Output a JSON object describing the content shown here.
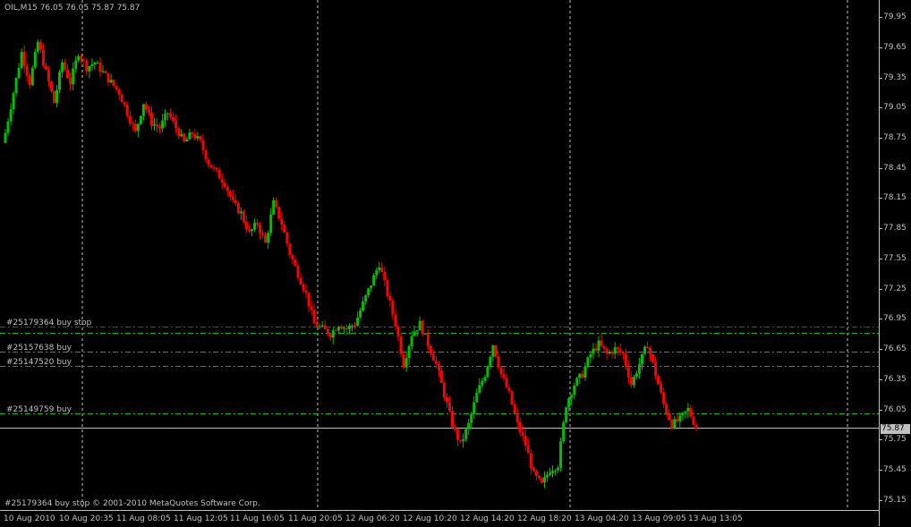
{
  "header": {
    "symbol_info": "OIL,M15  76.05 76.05 75.87 75.87"
  },
  "footer": {
    "copyright": "#25179364 buy stop © 2001-2010 MetaQuotes Software Corp."
  },
  "bid": {
    "label": "75.87",
    "value": 75.87
  },
  "colors": {
    "background": "#000000",
    "bull": "#00c000",
    "bear": "#ff0000",
    "grid": "#c0c0c0",
    "pending_line": "#ff0000",
    "order_line": "#00c000",
    "bid_line": "#c0c0c0"
  },
  "orders": [
    {
      "label": "#25179364 buy stop",
      "price": 76.87,
      "kind": "pending"
    },
    {
      "label": "",
      "price": 76.81,
      "kind": "order"
    },
    {
      "label": "#25157638 buy",
      "price": 76.62,
      "kind": "order"
    },
    {
      "label": "#25147520 buy",
      "price": 76.48,
      "kind": "order"
    },
    {
      "label": "#25149759 buy",
      "price": 76.01,
      "kind": "order"
    }
  ],
  "chart_data": {
    "type": "candlestick",
    "symbol": "OIL",
    "timeframe": "M15",
    "ylim": [
      75.05,
      80.12
    ],
    "y_ticks": [
      "79.95",
      "79.65",
      "79.35",
      "79.05",
      "78.75",
      "78.45",
      "78.15",
      "77.85",
      "77.55",
      "77.25",
      "76.95",
      "76.65",
      "76.35",
      "76.05",
      "75.75",
      "75.45",
      "75.15"
    ],
    "x_ticks": [
      "10 Aug 2010",
      "10 Aug 20:35",
      "11 Aug 08:05",
      "11 Aug 12:05",
      "11 Aug 16:05",
      "11 Aug 20:05",
      "12 Aug 06:20",
      "12 Aug 10:20",
      "12 Aug 14:20",
      "12 Aug 18:20",
      "13 Aug 04:20",
      "13 Aug 09:05",
      "13 Aug 13:05"
    ],
    "grid": "vertical day separators",
    "closes": [
      78.8,
      79.2,
      79.6,
      79.3,
      79.7,
      79.4,
      79.1,
      79.5,
      79.3,
      79.6,
      79.45,
      79.5,
      79.4,
      79.3,
      79.2,
      79.0,
      78.8,
      79.1,
      78.9,
      78.85,
      79.0,
      78.85,
      78.7,
      78.8,
      78.7,
      78.5,
      78.4,
      78.3,
      78.1,
      78.0,
      77.8,
      77.9,
      77.7,
      78.1,
      77.9,
      77.6,
      77.4,
      77.2,
      76.9,
      76.85,
      76.8,
      76.9,
      76.85,
      76.9,
      77.1,
      77.3,
      77.5,
      77.2,
      76.9,
      76.5,
      76.8,
      76.9,
      76.7,
      76.5,
      76.2,
      75.9,
      75.7,
      75.9,
      76.2,
      76.4,
      76.7,
      76.4,
      76.2,
      75.9,
      75.7,
      75.4,
      75.3,
      75.45,
      75.5,
      76.1,
      76.3,
      76.4,
      76.6,
      76.7,
      76.6,
      76.65,
      76.6,
      76.3,
      76.5,
      76.7,
      76.4,
      76.1,
      75.9,
      75.95,
      76.05,
      75.87
    ]
  },
  "price_axis": {
    "ticks": [
      "79.95",
      "79.65",
      "79.35",
      "79.05",
      "78.75",
      "78.45",
      "78.15",
      "77.85",
      "77.55",
      "77.25",
      "76.95",
      "76.65",
      "76.35",
      "76.05",
      "75.75",
      "75.45",
      "75.15"
    ]
  },
  "time_axis": {
    "ticks": [
      "10 Aug 2010",
      "10 Aug 20:35",
      "11 Aug 08:05",
      "11 Aug 12:05",
      "11 Aug 16:05",
      "11 Aug 20:05",
      "12 Aug 06:20",
      "12 Aug 10:20",
      "12 Aug 14:20",
      "12 Aug 18:20",
      "13 Aug 04:20",
      "13 Aug 09:05",
      "13 Aug 13:05"
    ]
  }
}
